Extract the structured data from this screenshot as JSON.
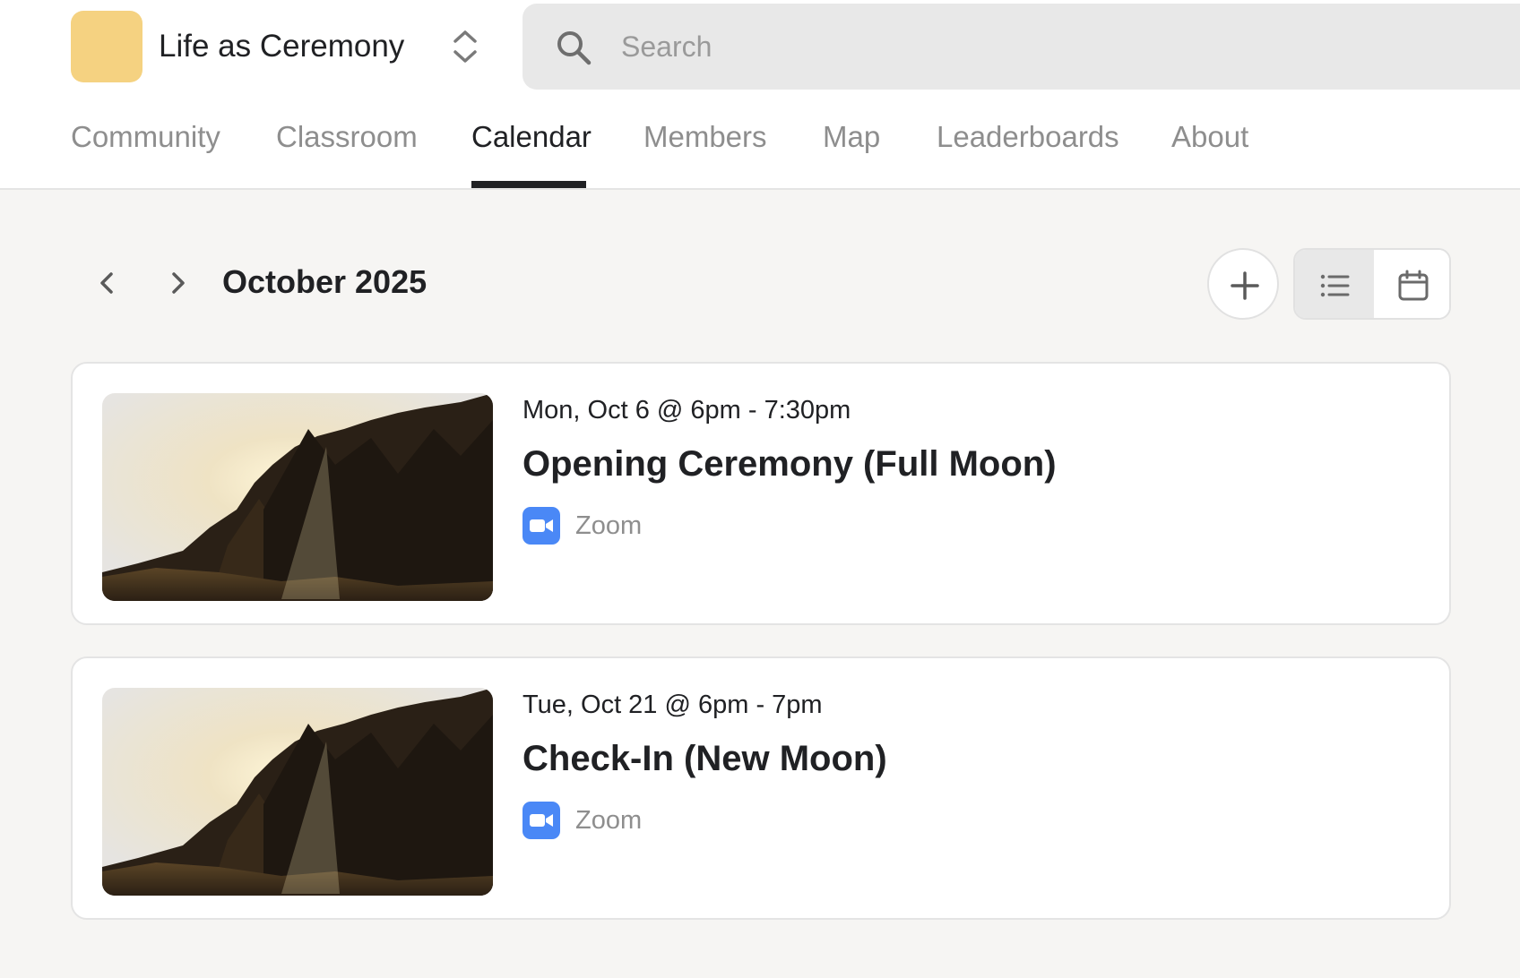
{
  "header": {
    "community_name": "Life as Ceremony",
    "logo_color": "#f5d281",
    "search_placeholder": "Search"
  },
  "tabs": [
    {
      "label": "Community",
      "active": false
    },
    {
      "label": "Classroom",
      "active": false
    },
    {
      "label": "Calendar",
      "active": true
    },
    {
      "label": "Members",
      "active": false
    },
    {
      "label": "Map",
      "active": false
    },
    {
      "label": "Leaderboards",
      "active": false
    },
    {
      "label": "About",
      "active": false
    }
  ],
  "calendar": {
    "month_label": "October 2025",
    "view_mode": "list"
  },
  "events": [
    {
      "date_time": "Mon, Oct 6 @ 6pm - 7:30pm",
      "title": "Opening Ceremony (Full Moon)",
      "location": "Zoom",
      "location_icon": "zoom-icon"
    },
    {
      "date_time": "Tue, Oct 21 @ 6pm - 7pm",
      "title": "Check-In (New Moon)",
      "location": "Zoom",
      "location_icon": "zoom-icon"
    }
  ],
  "colors": {
    "accent_dark": "#202124",
    "zoom_blue": "#4a88f6",
    "page_bg": "#f6f5f3"
  }
}
